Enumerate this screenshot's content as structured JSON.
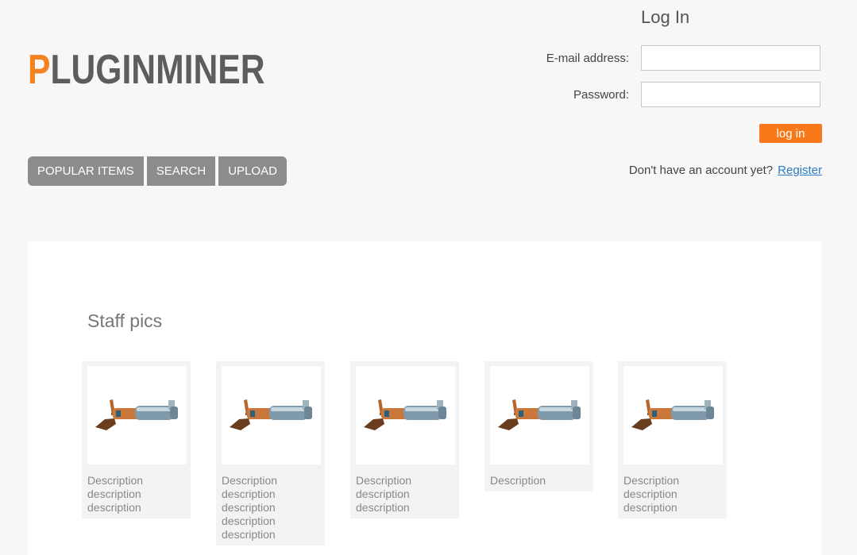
{
  "header": {
    "logo_first_letter": "P",
    "logo_rest": "LUGINMINER"
  },
  "login": {
    "title": "Log In",
    "email_label": "E-mail address:",
    "password_label": "Password:",
    "submit_label": "log in",
    "no_account_text": "Don't have an account yet?",
    "register_link": "Register"
  },
  "nav": {
    "items": [
      {
        "label": "POPULAR ITEMS"
      },
      {
        "label": "SEARCH"
      },
      {
        "label": "UPLOAD"
      }
    ]
  },
  "main": {
    "section_title": "Staff pics",
    "cards": [
      {
        "description": "Description description description"
      },
      {
        "description": "Description description description description description"
      },
      {
        "description": "Description description description"
      },
      {
        "description": "Description"
      },
      {
        "description": "Description description description"
      }
    ]
  },
  "colors": {
    "accent": "#f7791a",
    "logo_accent": "#f58220",
    "nav_bg": "#8c8c8c",
    "link": "#2a7bc1"
  },
  "icons": {
    "card_thumbnail": "blaster-gun-icon"
  }
}
